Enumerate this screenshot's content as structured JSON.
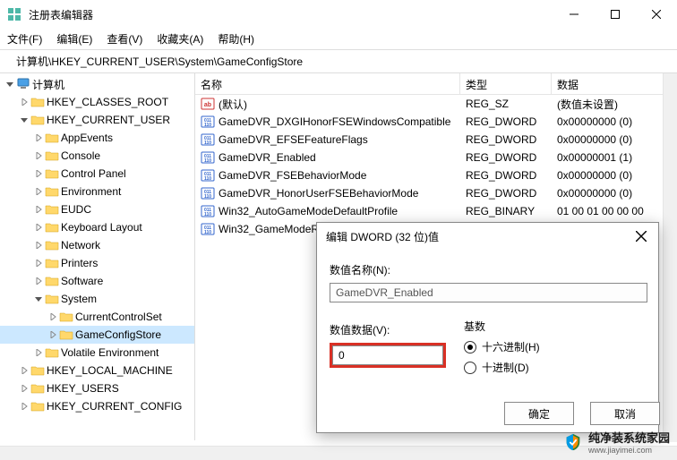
{
  "window": {
    "title": "注册表编辑器"
  },
  "menu": {
    "file": "文件(F)",
    "edit": "编辑(E)",
    "view": "查看(V)",
    "favorites": "收藏夹(A)",
    "help": "帮助(H)"
  },
  "address": "计算机\\HKEY_CURRENT_USER\\System\\GameConfigStore",
  "tree": [
    {
      "level": 0,
      "chevron": "down",
      "icon": "pc",
      "label": "计算机"
    },
    {
      "level": 1,
      "chevron": "right",
      "icon": "folder",
      "label": "HKEY_CLASSES_ROOT"
    },
    {
      "level": 1,
      "chevron": "down",
      "icon": "folder",
      "label": "HKEY_CURRENT_USER"
    },
    {
      "level": 2,
      "chevron": "right",
      "icon": "folder",
      "label": "AppEvents"
    },
    {
      "level": 2,
      "chevron": "right",
      "icon": "folder",
      "label": "Console"
    },
    {
      "level": 2,
      "chevron": "right",
      "icon": "folder",
      "label": "Control Panel"
    },
    {
      "level": 2,
      "chevron": "right",
      "icon": "folder",
      "label": "Environment"
    },
    {
      "level": 2,
      "chevron": "right",
      "icon": "folder",
      "label": "EUDC"
    },
    {
      "level": 2,
      "chevron": "right",
      "icon": "folder",
      "label": "Keyboard Layout"
    },
    {
      "level": 2,
      "chevron": "right",
      "icon": "folder",
      "label": "Network"
    },
    {
      "level": 2,
      "chevron": "right",
      "icon": "folder",
      "label": "Printers"
    },
    {
      "level": 2,
      "chevron": "right",
      "icon": "folder",
      "label": "Software"
    },
    {
      "level": 2,
      "chevron": "down",
      "icon": "folder",
      "label": "System"
    },
    {
      "level": 3,
      "chevron": "right",
      "icon": "folder",
      "label": "CurrentControlSet"
    },
    {
      "level": 3,
      "chevron": "right",
      "icon": "folder",
      "label": "GameConfigStore",
      "selected": true
    },
    {
      "level": 2,
      "chevron": "right",
      "icon": "folder",
      "label": "Volatile Environment"
    },
    {
      "level": 1,
      "chevron": "right",
      "icon": "folder",
      "label": "HKEY_LOCAL_MACHINE"
    },
    {
      "level": 1,
      "chevron": "right",
      "icon": "folder",
      "label": "HKEY_USERS"
    },
    {
      "level": 1,
      "chevron": "right",
      "icon": "folder",
      "label": "HKEY_CURRENT_CONFIG"
    }
  ],
  "list": {
    "headers": {
      "name": "名称",
      "type": "类型",
      "data": "数据"
    },
    "rows": [
      {
        "icon": "str",
        "name": "(默认)",
        "type": "REG_SZ",
        "data": "(数值未设置)"
      },
      {
        "icon": "bin",
        "name": "GameDVR_DXGIHonorFSEWindowsCompatible",
        "type": "REG_DWORD",
        "data": "0x00000000 (0)"
      },
      {
        "icon": "bin",
        "name": "GameDVR_EFSEFeatureFlags",
        "type": "REG_DWORD",
        "data": "0x00000000 (0)"
      },
      {
        "icon": "bin",
        "name": "GameDVR_Enabled",
        "type": "REG_DWORD",
        "data": "0x00000001 (1)"
      },
      {
        "icon": "bin",
        "name": "GameDVR_FSEBehaviorMode",
        "type": "REG_DWORD",
        "data": "0x00000000 (0)"
      },
      {
        "icon": "bin",
        "name": "GameDVR_HonorUserFSEBehaviorMode",
        "type": "REG_DWORD",
        "data": "0x00000000 (0)"
      },
      {
        "icon": "bin",
        "name": "Win32_AutoGameModeDefaultProfile",
        "type": "REG_BINARY",
        "data": "01 00 01 00 00 00"
      },
      {
        "icon": "bin",
        "name": "Win32_GameModeR",
        "type": "",
        "data": ""
      }
    ]
  },
  "dialog": {
    "title": "编辑 DWORD (32 位)值",
    "name_label": "数值名称(N):",
    "name_value": "GameDVR_Enabled",
    "data_label": "数值数据(V):",
    "data_value": "0",
    "base_label": "基数",
    "radio_hex": "十六进制(H)",
    "radio_dec": "十进制(D)",
    "ok": "确定",
    "cancel": "取消"
  },
  "watermark": {
    "text": "纯净装系统家园",
    "sub": "www.jiayimei.com"
  }
}
